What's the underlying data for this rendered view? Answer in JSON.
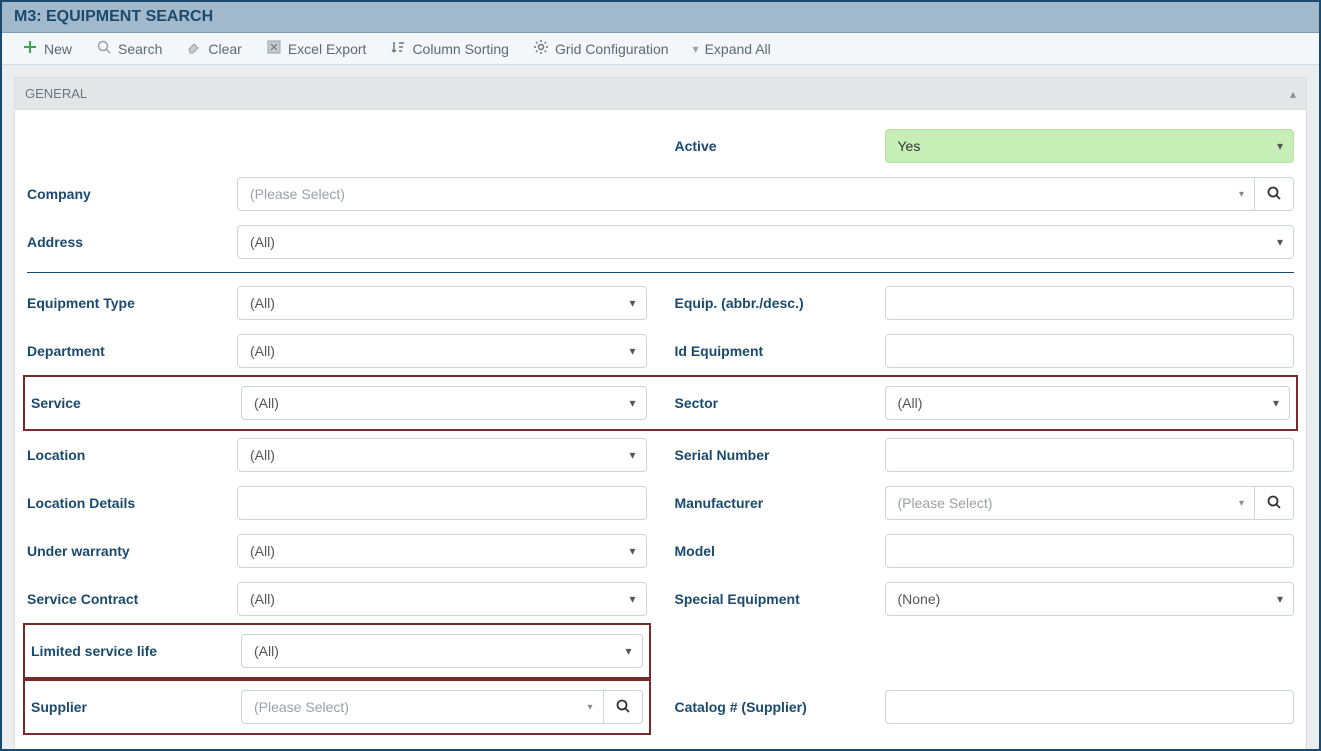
{
  "title": "M3: EQUIPMENT SEARCH",
  "toolbar": {
    "new": "New",
    "search": "Search",
    "clear": "Clear",
    "excel": "Excel Export",
    "sort": "Column Sorting",
    "grid": "Grid Configuration",
    "expand": "Expand All"
  },
  "section": {
    "general": "GENERAL"
  },
  "labels": {
    "active": "Active",
    "company": "Company",
    "address": "Address",
    "equipment_type": "Equipment Type",
    "equip_abbr": "Equip. (abbr./desc.)",
    "department": "Department",
    "id_equipment": "Id Equipment",
    "service": "Service",
    "sector": "Sector",
    "location": "Location",
    "serial_number": "Serial Number",
    "location_details": "Location Details",
    "manufacturer": "Manufacturer",
    "under_warranty": "Under warranty",
    "model": "Model",
    "service_contract": "Service Contract",
    "special_equipment": "Special Equipment",
    "limited_service_life": "Limited service life",
    "supplier": "Supplier",
    "catalog_supplier": "Catalog # (Supplier)"
  },
  "values": {
    "active": "Yes",
    "company": "(Please Select)",
    "address": "(All)",
    "equipment_type": "(All)",
    "department": "(All)",
    "service": "(All)",
    "sector": "(All)",
    "location": "(All)",
    "manufacturer": "(Please Select)",
    "under_warranty": "(All)",
    "service_contract": "(All)",
    "special_equipment": "(None)",
    "limited_service_life": "(All)",
    "supplier": "(Please Select)"
  }
}
